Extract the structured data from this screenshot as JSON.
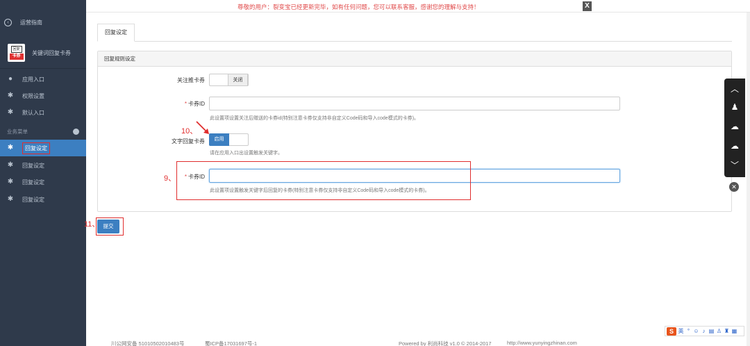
{
  "notice": {
    "text": "尊敬的用户：裂变宝已经更新完毕，如有任何问题，您可以联系客服，感谢您的理解与支持！",
    "close": "X"
  },
  "sidebar": {
    "back": "运营指南",
    "app_name": "关键词回复卡券",
    "logo_top": "回复",
    "logo_bottom": "卡券",
    "items": [
      {
        "label": "应用入口"
      },
      {
        "label": "权限设置"
      },
      {
        "label": "默认入口"
      }
    ],
    "section": "业务菜单",
    "menu": [
      {
        "label": "回复设定",
        "active": true
      },
      {
        "label": "回复设定"
      },
      {
        "label": "回复设定"
      },
      {
        "label": "回复设定"
      }
    ]
  },
  "tab": {
    "label": "回复设定"
  },
  "panel": {
    "title": "回复规则设定",
    "follow_label": "关注推卡券",
    "follow_toggle": "关闭",
    "card_id_label": "卡券ID",
    "card_id_help": "此设置项设置关注后赠送的卡券id(特别注意卡券仅支持非自定义Code码和导入code模式的卡券)。",
    "text_label": "文字回复卡券",
    "text_toggle": "启用",
    "text_help": "请在应用入口出设置触发关键字。",
    "card_id2_label": "卡券ID",
    "card_id2_help": "此设置项设置触发关键字后回复的卡券(特别注意卡券仅支持非自定义Code码和导入code模式的卡券)。",
    "required_mark": "*"
  },
  "submit": {
    "label": "提交"
  },
  "annotations": {
    "n9": "9、",
    "n10": "10、",
    "n11": "11、"
  },
  "footer": {
    "police": "川公网安备 51010502010483号",
    "icp": "蜀ICP备17031697号-1",
    "powered": "Powered by 利尚科技 v1.0 © 2014-2017",
    "url": "http://www.yunyingzhinan.com"
  },
  "ime": {
    "label": "S",
    "lang": "英"
  },
  "colors": {
    "sidebar": "#2f3a4b",
    "accent": "#3c7fc1",
    "annotation": "#e02d2d"
  }
}
